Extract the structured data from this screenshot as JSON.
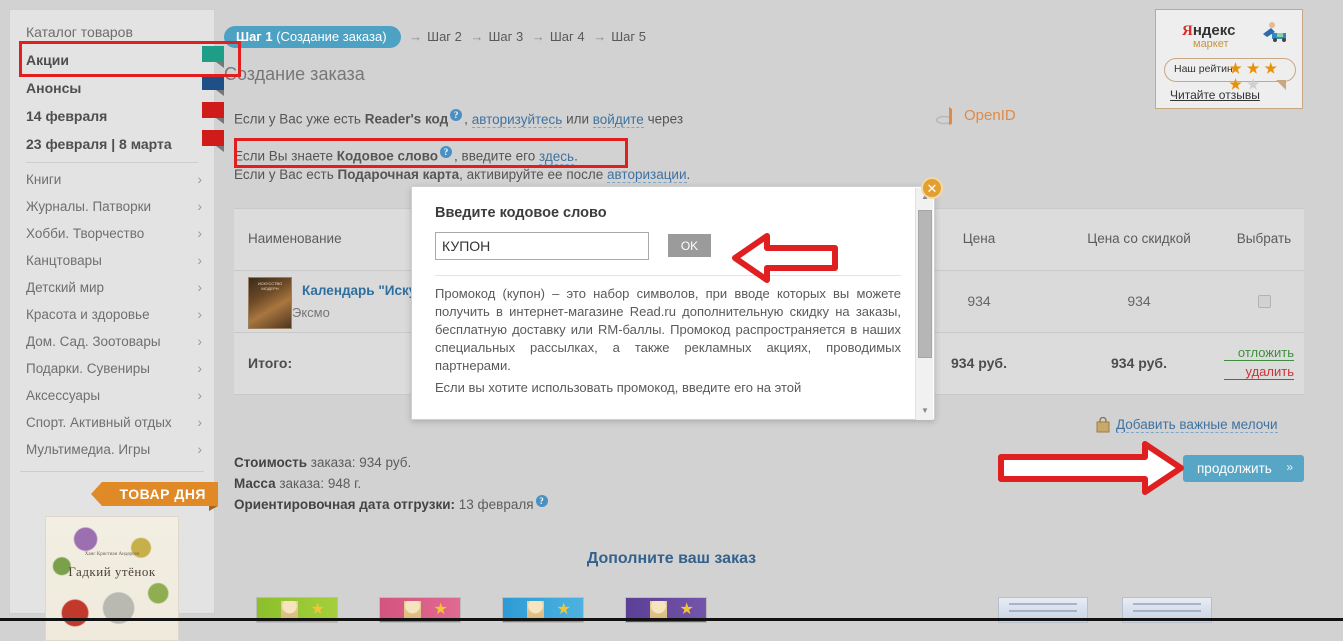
{
  "sidebar": {
    "catalog_label": "Каталог товаров",
    "promos": [
      {
        "label": "Акции",
        "flag": "#1f9e87"
      },
      {
        "label": "Анонсы",
        "flag": "#1e4f86"
      },
      {
        "label": "14 февраля",
        "flag": "#d01b1b"
      },
      {
        "label": "23 февраля | 8 марта",
        "flag": "#d01b1b"
      }
    ],
    "categories": [
      "Книги",
      "Журналы. Патворки",
      "Хобби. Творчество",
      "Канцтовары",
      "Детский мир",
      "Красота и здоровье",
      "Дом. Сад. Зоотовары",
      "Подарки. Сувениры",
      "Аксессуары",
      "Спорт. Активный отдых",
      "Мультимедиа. Игры"
    ],
    "chevron": "›",
    "product_of_day": {
      "banner": "ТОВАР ДНЯ",
      "book_title": "Гадкий утёнок",
      "book_author": "Ханс Кристиан Андерсен"
    }
  },
  "steps": {
    "current": "Шаг 1",
    "current_suffix": "(Создание заказа)",
    "arrow": "→",
    "rest": [
      "Шаг 2",
      "Шаг 3",
      "Шаг 4",
      "Шаг 5"
    ]
  },
  "page_title": "Создание заказа",
  "info": {
    "readers": {
      "prefix": "Если у Вас уже есть ",
      "bold": "Reader's код",
      "mid": ", ",
      "link1": "авторизуйтесь",
      "or": " или ",
      "link2": "войдите",
      "suffix": " через"
    },
    "code_word": {
      "prefix": "Если Вы знаете ",
      "bold": "Кодовое слово",
      "mid": ", введите его ",
      "link": "здесь",
      "suffix": "."
    },
    "gift_card": {
      "prefix": "Если у Вас есть ",
      "bold": "Подарочная карта",
      "mid": ", активируйте ее после ",
      "link": "авторизации",
      "suffix": "."
    },
    "openid_label": "OpenID",
    "help_icon": "?"
  },
  "table": {
    "headers": {
      "name": "Наименование",
      "qty": "",
      "price": "Цена",
      "discount": "Цена со скидкой",
      "select": "Выбрать"
    },
    "rows": [
      {
        "title": "Календарь \"Иску",
        "publisher": "Эксмо",
        "thumb_text": "ИСКУССТВО МОДЕРН",
        "price": "934",
        "discount": "934"
      }
    ],
    "total": {
      "label": "Итого:",
      "price": "934 руб.",
      "discount": "934 руб.",
      "action_defer": "отложить",
      "action_delete": "удалить"
    }
  },
  "summary": {
    "cost_label": "Стоимость",
    "cost_rest": " заказа: 934 руб.",
    "mass_label": "Масса",
    "mass_rest": " заказа: 948 г.",
    "ship_label": "Ориентировочная дата отгрузки:",
    "ship_value": " 13 февраля"
  },
  "actions": {
    "add_extras": "Добавить важные мелочи",
    "continue": "продолжить",
    "continue_chevron": "»"
  },
  "promo_section": {
    "title": "Дополните ваш заказ",
    "thumbs": [
      "green-doll",
      "pink-doll",
      "blue-doll",
      "purple-doll"
    ],
    "right_thumbs": [
      "pale-card-1",
      "pale-card-2"
    ]
  },
  "yandex_market": {
    "logo_ya": "Я",
    "logo_ndex": "ндекс",
    "market": "маркет",
    "rating_label": "Наш рейтинг",
    "stars_filled": 4,
    "stars_total": 5,
    "reviews_link": "Читайте отзывы"
  },
  "modal": {
    "title": "Введите кодовое слово",
    "input_value": "КУПОН",
    "input_placeholder": "",
    "ok_label": "OK",
    "close_label": "✕",
    "paragraph_1": "Промокод (купон) – это набор символов, при вводе которых вы можете получить в интернет-магазине Read.ru дополнительную скидку на заказы, бесплатную доставку или RM-баллы. Промокод распространяется в наших специальных рассылках, а также рекламных акциях, проводимых партнерами.",
    "paragraph_2": "Если вы хотите использовать промокод, введите его на этой",
    "scroll_up": "▲",
    "scroll_down": "▼"
  },
  "annotations": {
    "accent_red": "#e02020",
    "arrow_to_ok": "arrow-pointing-left-to-ok-button",
    "arrow_to_continue": "arrow-pointing-right-to-continue-button"
  }
}
